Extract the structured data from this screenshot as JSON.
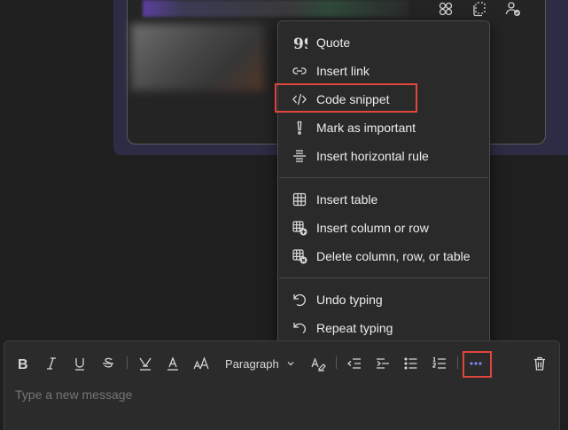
{
  "context_menu": {
    "group_1": [
      {
        "label": "Quote",
        "icon": "quote-icon"
      },
      {
        "label": "Insert link",
        "icon": "link-icon"
      },
      {
        "label": "Code snippet",
        "icon": "code-icon"
      },
      {
        "label": "Mark as important",
        "icon": "important-icon"
      },
      {
        "label": "Insert horizontal rule",
        "icon": "horizontal-rule-icon"
      }
    ],
    "group_2": [
      {
        "label": "Insert table",
        "icon": "table-icon"
      },
      {
        "label": "Insert column or row",
        "icon": "table-add-icon"
      },
      {
        "label": "Delete column, row, or table",
        "icon": "table-delete-icon"
      }
    ],
    "group_3": [
      {
        "label": "Undo typing",
        "icon": "undo-icon"
      },
      {
        "label": "Repeat typing",
        "icon": "redo-icon"
      }
    ]
  },
  "toolbar": {
    "paragraph_label": "Paragraph",
    "buttons": [
      "bold",
      "italic",
      "underline",
      "strikethrough",
      "highlight",
      "font-color",
      "font-size",
      "paragraph",
      "format-painter",
      "decrease-indent",
      "increase-indent",
      "bulleted-list",
      "numbered-list",
      "more-options",
      "delete"
    ]
  },
  "composer": {
    "placeholder": "Type a new message"
  },
  "colors": {
    "highlight_border": "#e0463c",
    "accent_more": "#7f85f5",
    "menu_bg": "#2a2a2a",
    "page_bg": "#1f1f1f"
  }
}
